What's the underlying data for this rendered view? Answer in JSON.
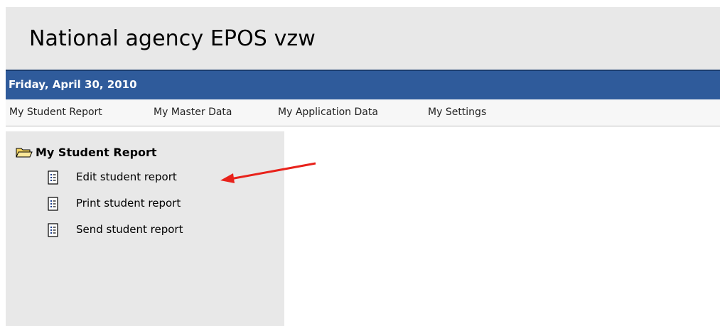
{
  "header": {
    "title": "National agency EPOS vzw"
  },
  "datebar": {
    "date": "Friday, April 30, 2010"
  },
  "menu": {
    "items": [
      {
        "label": "My Student Report"
      },
      {
        "label": "My Master Data"
      },
      {
        "label": "My Application Data"
      },
      {
        "label": "My Settings"
      }
    ]
  },
  "sidebar": {
    "folder": {
      "label": "My Student Report",
      "icon": "folder-open-icon"
    },
    "links": [
      {
        "label": "Edit student report",
        "icon": "document-list-icon"
      },
      {
        "label": "Print student report",
        "icon": "document-list-icon"
      },
      {
        "label": "Send student report",
        "icon": "document-list-icon"
      }
    ]
  },
  "annotation": {
    "arrow_color": "#e8221b",
    "arrow_target": "Edit student report"
  },
  "colors": {
    "datebar": "#2f5b9b",
    "header": "#e8e8e8",
    "sidebar": "#e8e8e8"
  }
}
